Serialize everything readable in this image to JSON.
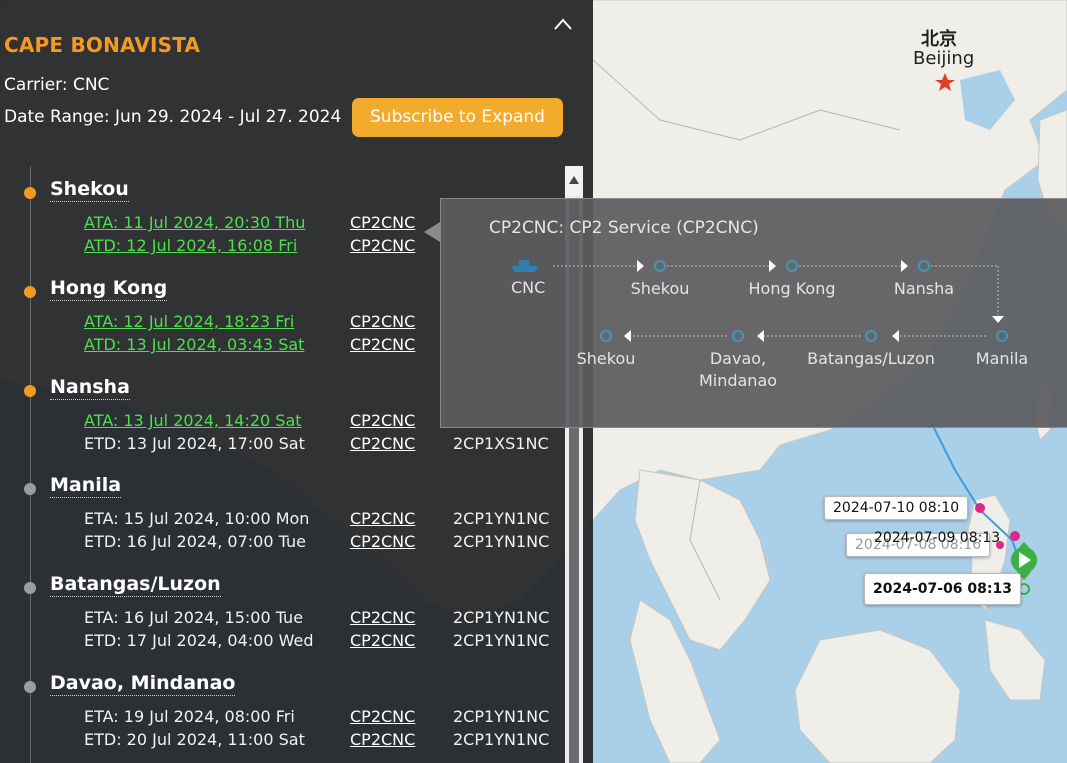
{
  "vessel": {
    "name": "CAPE BONAVISTA",
    "carrier": "Carrier: CNC",
    "date_range": "Date Range: Jun 29. 2024 - Jul 27. 2024",
    "subscribe_label": "Subscribe to Expand"
  },
  "ports": [
    {
      "name": "Shekou",
      "status": "done",
      "rows": [
        {
          "text": "ATA: 11 Jul 2024, 20:30 Thu",
          "service": "CP2CNC",
          "voyage": "",
          "actual": true
        },
        {
          "text": "ATD: 12 Jul 2024, 16:08 Fri",
          "service": "CP2CNC",
          "voyage": "",
          "actual": true
        }
      ]
    },
    {
      "name": "Hong Kong",
      "status": "done",
      "rows": [
        {
          "text": "ATA: 12 Jul 2024, 18:23 Fri",
          "service": "CP2CNC",
          "voyage": "",
          "actual": true
        },
        {
          "text": "ATD: 13 Jul 2024, 03:43 Sat",
          "service": "CP2CNC",
          "voyage": "",
          "actual": true
        }
      ]
    },
    {
      "name": "Nansha",
      "status": "done",
      "rows": [
        {
          "text": "ATA: 13 Jul 2024, 14:20 Sat",
          "service": "CP2CNC",
          "voyage": "",
          "actual": true
        },
        {
          "text": "ETD: 13 Jul 2024, 17:00 Sat",
          "service": "CP2CNC",
          "voyage": "2CP1XS1NC",
          "actual": false
        }
      ]
    },
    {
      "name": "Manila",
      "status": "todo",
      "rows": [
        {
          "text": "ETA: 15 Jul 2024, 10:00 Mon",
          "service": "CP2CNC",
          "voyage": "2CP1YN1NC",
          "actual": false
        },
        {
          "text": "ETD: 16 Jul 2024, 07:00 Tue",
          "service": "CP2CNC",
          "voyage": "2CP1YN1NC",
          "actual": false
        }
      ]
    },
    {
      "name": "Batangas/Luzon",
      "status": "todo",
      "rows": [
        {
          "text": "ETA: 16 Jul 2024, 15:00 Tue",
          "service": "CP2CNC",
          "voyage": "2CP1YN1NC",
          "actual": false
        },
        {
          "text": "ETD: 17 Jul 2024, 04:00 Wed",
          "service": "CP2CNC",
          "voyage": "2CP1YN1NC",
          "actual": false
        }
      ]
    },
    {
      "name": "Davao, Mindanao",
      "status": "todo",
      "rows": [
        {
          "text": "ETA: 19 Jul 2024, 08:00 Fri",
          "service": "CP2CNC",
          "voyage": "2CP1YN1NC",
          "actual": false
        },
        {
          "text": "ETD: 20 Jul 2024, 11:00 Sat",
          "service": "CP2CNC",
          "voyage": "2CP1YN1NC",
          "actual": false
        }
      ]
    }
  ],
  "service_popup": {
    "title": "CP2CNC: CP2 Service (CP2CNC)",
    "origin": "CNC",
    "stops_row1": [
      "Shekou",
      "Hong Kong",
      "Nansha",
      "Manila"
    ],
    "stops_row2": [
      "Batangas/Luzon",
      "Davao,\nMindanao",
      "Shekou"
    ]
  },
  "map": {
    "city_cn": "北京",
    "city_en": "Beijing",
    "track_labels": [
      "2024-07-10 08:10",
      "2024-07-09 08:13",
      "2024-07-08 08:16",
      "2024-07-06 08:13"
    ]
  },
  "colors": {
    "accent": "#f39a1f",
    "button": "#f3ab2d",
    "actual_green": "#4ce04c",
    "track_blue": "#3a9fd8",
    "track_pink": "#e0288a",
    "ship_green": "#3cb043"
  }
}
